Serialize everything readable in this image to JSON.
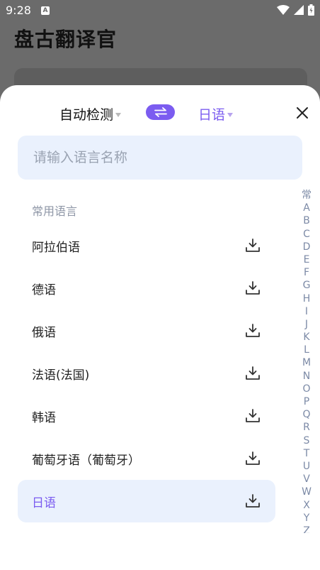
{
  "status_bar": {
    "time": "9:28",
    "notification_glyph": "A",
    "icons": [
      "wifi-icon",
      "signal-icon",
      "battery-icon"
    ]
  },
  "app": {
    "title": "盘古翻译官"
  },
  "sheet": {
    "source_lang": "自动检测",
    "target_lang": "日语",
    "search_placeholder": "请输入语言名称",
    "section_title": "常用语言",
    "languages": [
      {
        "name": "阿拉伯语",
        "selected": false
      },
      {
        "name": "德语",
        "selected": false
      },
      {
        "name": "俄语",
        "selected": false
      },
      {
        "name": "法语(法国)",
        "selected": false
      },
      {
        "name": "韩语",
        "selected": false
      },
      {
        "name": "葡萄牙语（葡萄牙）",
        "selected": false
      },
      {
        "name": "日语",
        "selected": true
      }
    ],
    "index_letters": [
      "常",
      "A",
      "B",
      "C",
      "D",
      "E",
      "F",
      "G",
      "H",
      "I",
      "J",
      "K",
      "L",
      "M",
      "N",
      "O",
      "P",
      "Q",
      "R",
      "S",
      "T",
      "U",
      "V",
      "W",
      "X",
      "Y",
      "Z"
    ]
  },
  "colors": {
    "accent": "#7b5cf0",
    "search_bg": "#eaf1fd",
    "index_color": "#7c8aa6",
    "overlay": "#6b6b6b"
  }
}
